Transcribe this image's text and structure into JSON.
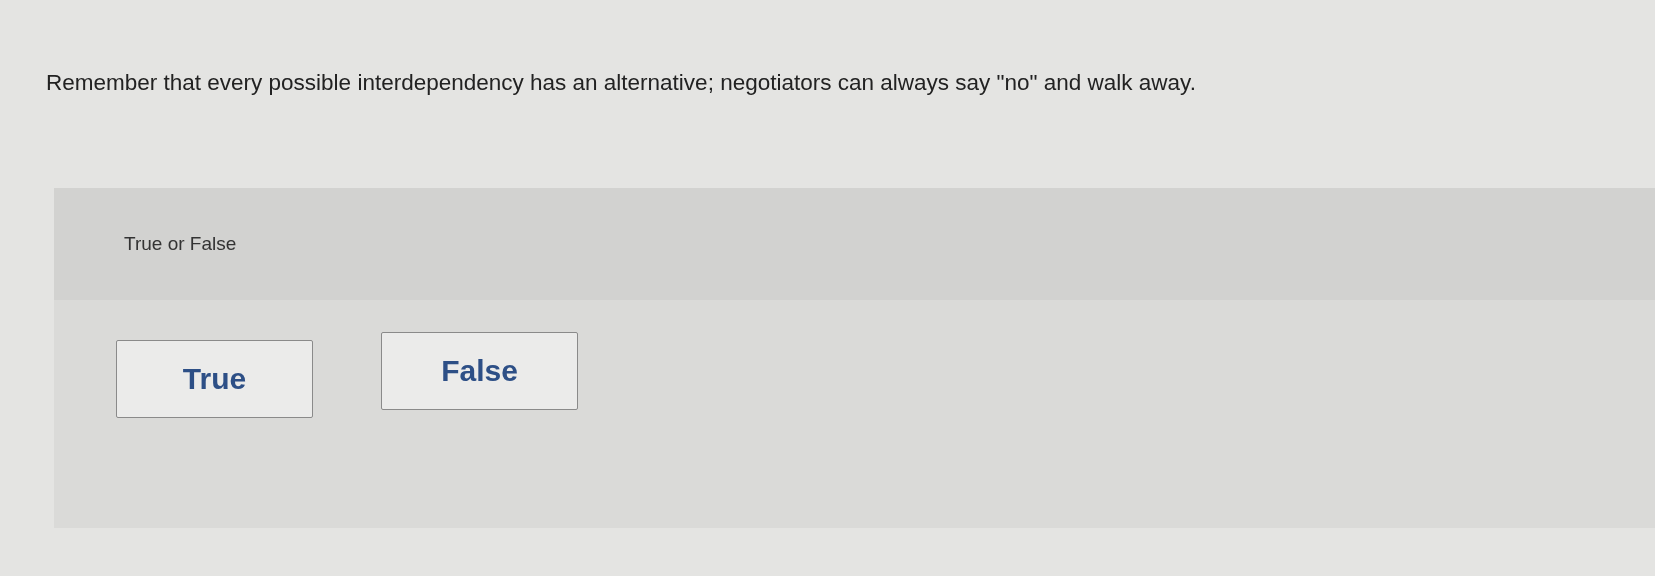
{
  "question": {
    "prompt": "Remember that every possible interdependency has an alternative; negotiators can always say \"no\" and walk away."
  },
  "answer_panel": {
    "instruction": "True or False",
    "options": [
      {
        "label": "True",
        "selected": false
      },
      {
        "label": "False",
        "selected": false
      }
    ]
  }
}
